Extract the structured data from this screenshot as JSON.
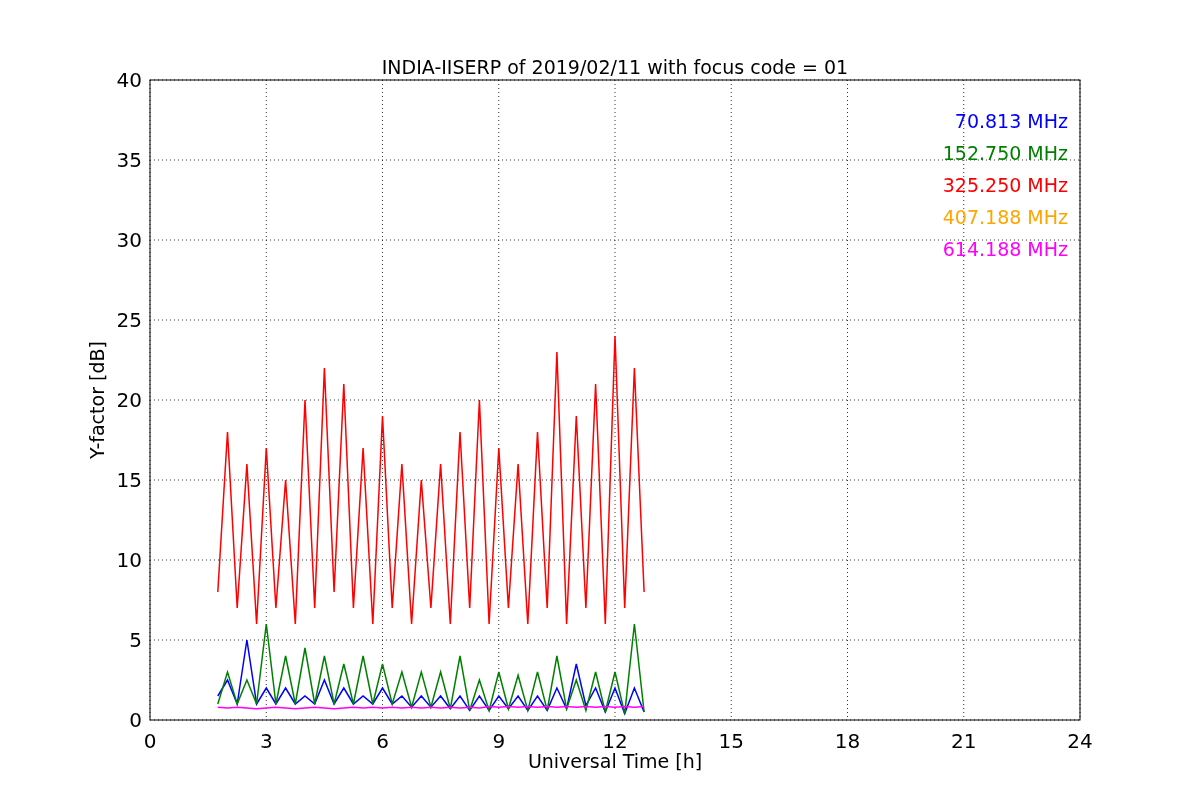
{
  "chart_data": {
    "type": "line",
    "title": "INDIA-IISERP of 2019/02/11 with focus code = 01",
    "xlabel": "Universal Time [h]",
    "ylabel": "Y-factor [dB]",
    "x": [
      1.75,
      2,
      2.25,
      2.5,
      2.75,
      3,
      3.25,
      3.5,
      3.75,
      4,
      4.25,
      4.5,
      4.75,
      5,
      5.25,
      5.5,
      5.75,
      6,
      6.25,
      6.5,
      6.75,
      7,
      7.25,
      7.5,
      7.75,
      8,
      8.25,
      8.5,
      8.75,
      9,
      9.25,
      9.5,
      9.75,
      10,
      10.25,
      10.5,
      10.75,
      11,
      11.25,
      11.5,
      11.75,
      12,
      12.25,
      12.5,
      12.75
    ],
    "grid": true,
    "xlim": [
      0,
      24
    ],
    "ylim": [
      0,
      40
    ],
    "xticks": [
      0,
      3,
      6,
      9,
      12,
      15,
      18,
      21,
      24
    ],
    "yticks": [
      0,
      5,
      10,
      15,
      20,
      25,
      30,
      35,
      40
    ],
    "series": [
      {
        "name": "70.813 MHz",
        "color": "#0000ff",
        "values": [
          1.5,
          2.5,
          1,
          5,
          1,
          2,
          1,
          2,
          1,
          1.5,
          1,
          2.5,
          1,
          2,
          1,
          1.5,
          1,
          2,
          1,
          1.5,
          0.8,
          1.5,
          0.8,
          1.5,
          0.7,
          1.5,
          0.6,
          1.5,
          0.6,
          1.5,
          0.7,
          1.5,
          0.6,
          1.5,
          0.6,
          2,
          0.7,
          3.5,
          0.9,
          2,
          0.5,
          2,
          0.4,
          2,
          0.5
        ]
      },
      {
        "name": "152.750 MHz",
        "color": "#008000",
        "values": [
          1,
          3,
          1,
          2.5,
          1,
          6,
          1,
          4,
          1,
          4.5,
          1,
          4,
          1,
          3.5,
          1,
          4,
          1,
          3.5,
          1,
          3,
          0.8,
          3,
          0.8,
          3,
          0.7,
          4,
          0.6,
          2.5,
          0.6,
          3,
          0.7,
          2.8,
          0.6,
          3,
          0.6,
          4,
          0.7,
          2.5,
          0.6,
          3,
          0.5,
          3,
          0.4,
          6,
          0.5
        ]
      },
      {
        "name": "325.250 MHz",
        "color": "#ff0000",
        "values": [
          8,
          18,
          7,
          16,
          6,
          17,
          7,
          15,
          6,
          20,
          7,
          22,
          8,
          21,
          7,
          17,
          6,
          19,
          7,
          16,
          6,
          15,
          7,
          16,
          6,
          18,
          7,
          20,
          6,
          17,
          7,
          16,
          6,
          18,
          7,
          23,
          6,
          19,
          7,
          21,
          6,
          24,
          7,
          22,
          8
        ]
      },
      {
        "name": "407.188 MHz",
        "color": "#ffa500",
        "values": [
          null,
          null,
          null,
          null,
          null,
          null,
          null,
          null,
          null,
          null,
          null,
          null,
          null,
          null,
          null,
          null,
          null,
          null,
          null,
          null,
          null,
          null,
          null,
          null,
          null,
          null,
          null,
          null,
          null,
          null,
          null,
          null,
          null,
          null,
          null,
          null,
          null,
          null,
          null,
          null,
          null,
          null,
          null,
          null,
          null
        ]
      },
      {
        "name": "614.188 MHz",
        "color": "#ff00ff",
        "values": [
          0.8,
          0.75,
          0.8,
          0.75,
          0.7,
          0.75,
          0.8,
          0.75,
          0.7,
          0.75,
          0.8,
          0.75,
          0.7,
          0.75,
          0.8,
          0.75,
          0.8,
          0.75,
          0.8,
          0.75,
          0.8,
          0.75,
          0.8,
          0.75,
          0.8,
          0.75,
          0.8,
          0.75,
          0.85,
          0.8,
          0.85,
          0.8,
          0.85,
          0.8,
          0.85,
          0.8,
          0.85,
          0.8,
          0.85,
          0.8,
          0.85,
          0.8,
          0.85,
          0.8,
          0.85
        ]
      }
    ]
  }
}
